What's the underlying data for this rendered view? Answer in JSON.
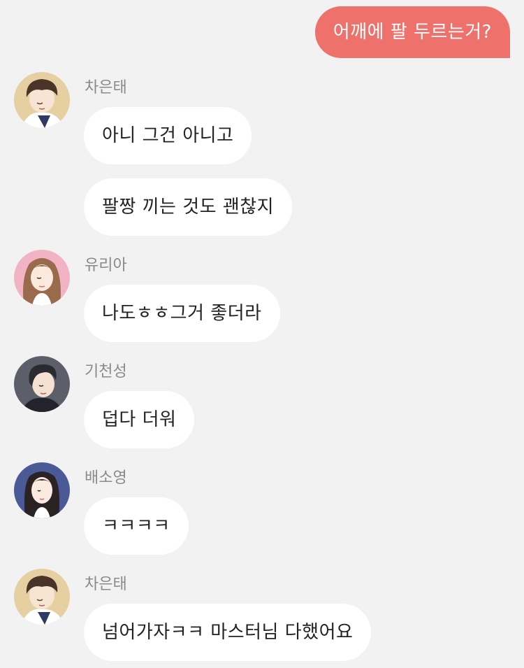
{
  "outgoing": [
    {
      "text": "어깨에 팔 두르는거?"
    }
  ],
  "groups": [
    {
      "sender": "차은태",
      "avatar": "avatar-chaeuntae",
      "messages": [
        "아니 그건 아니고",
        "팔짱 끼는 것도 괜찮지"
      ]
    },
    {
      "sender": "유리아",
      "avatar": "avatar-yuria",
      "messages": [
        "나도ㅎㅎ그거 좋더라"
      ]
    },
    {
      "sender": "기천성",
      "avatar": "avatar-gicheonseong",
      "messages": [
        "덥다 더워"
      ]
    },
    {
      "sender": "배소영",
      "avatar": "avatar-baesoyoung",
      "messages": [
        "ㅋㅋㅋㅋ"
      ]
    },
    {
      "sender": "차은태",
      "avatar": "avatar-chaeuntae",
      "messages": [
        "넘어가자ㅋㅋ 마스터님 다했어요"
      ]
    }
  ],
  "colors": {
    "background": "#f2f2f2",
    "outgoing_bubble": "#ef716c",
    "incoming_bubble": "#ffffff",
    "sender_name": "#8a8a8a"
  }
}
